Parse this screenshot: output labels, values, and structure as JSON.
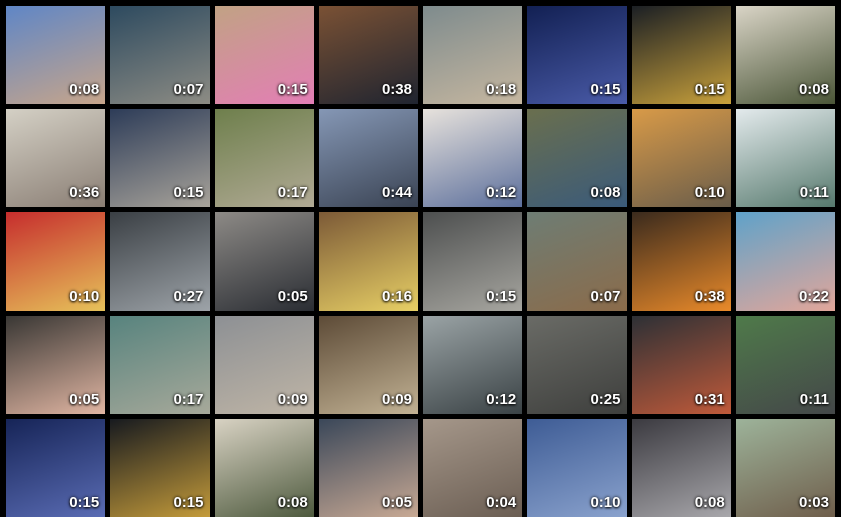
{
  "gallery": {
    "tiles": [
      {
        "duration": "0:08",
        "colors": [
          "#5f86c6",
          "#c7a58a"
        ]
      },
      {
        "duration": "0:07",
        "colors": [
          "#2d4a5f",
          "#8d8c84"
        ]
      },
      {
        "duration": "0:15",
        "colors": [
          "#c1a284",
          "#e37eb5"
        ]
      },
      {
        "duration": "0:38",
        "colors": [
          "#7a5134",
          "#1f2430"
        ]
      },
      {
        "duration": "0:18",
        "colors": [
          "#7e8b8d",
          "#c6b7a0"
        ]
      },
      {
        "duration": "0:15",
        "colors": [
          "#122053",
          "#4a5ba8"
        ]
      },
      {
        "duration": "0:15",
        "colors": [
          "#1b1f24",
          "#c9a13b"
        ]
      },
      {
        "duration": "0:08",
        "colors": [
          "#d9d4c6",
          "#4a5537"
        ]
      },
      {
        "duration": "0:36",
        "colors": [
          "#d4d0c5",
          "#8a7e74"
        ]
      },
      {
        "duration": "0:15",
        "colors": [
          "#2d3c58",
          "#a8a39a"
        ]
      },
      {
        "duration": "0:17",
        "colors": [
          "#6e7f4c",
          "#b1aa95"
        ]
      },
      {
        "duration": "0:44",
        "colors": [
          "#8597b5",
          "#3a4353"
        ]
      },
      {
        "duration": "0:12",
        "colors": [
          "#e7e2dc",
          "#5c6f9c"
        ]
      },
      {
        "duration": "0:08",
        "colors": [
          "#6a6f4e",
          "#3a5a7a"
        ]
      },
      {
        "duration": "0:10",
        "colors": [
          "#d89a48",
          "#6a5d4a"
        ]
      },
      {
        "duration": "0:11",
        "colors": [
          "#e3eaec",
          "#56796d"
        ]
      },
      {
        "duration": "0:10",
        "colors": [
          "#c62d2d",
          "#e6c25a"
        ]
      },
      {
        "duration": "0:27",
        "colors": [
          "#3a3f44",
          "#9da3a8"
        ]
      },
      {
        "duration": "0:05",
        "colors": [
          "#8d8a86",
          "#2a2d33"
        ]
      },
      {
        "duration": "0:16",
        "colors": [
          "#7c5a37",
          "#e7cf65"
        ]
      },
      {
        "duration": "0:15",
        "colors": [
          "#4d4f4f",
          "#a7a6a0"
        ]
      },
      {
        "duration": "0:07",
        "colors": [
          "#6e7d74",
          "#8b6b4a"
        ]
      },
      {
        "duration": "0:38",
        "colors": [
          "#3a2a1d",
          "#e98a2a"
        ]
      },
      {
        "duration": "0:22",
        "colors": [
          "#5fa2c9",
          "#e2a69a"
        ]
      },
      {
        "duration": "0:05",
        "colors": [
          "#393734",
          "#e0b5a2"
        ]
      },
      {
        "duration": "0:17",
        "colors": [
          "#57837e",
          "#a7a99a"
        ]
      },
      {
        "duration": "0:09",
        "colors": [
          "#8d9094",
          "#bfb5a6"
        ]
      },
      {
        "duration": "0:09",
        "colors": [
          "#5d4b37",
          "#c2b294"
        ]
      },
      {
        "duration": "0:12",
        "colors": [
          "#9aa3a5",
          "#3a4245"
        ]
      },
      {
        "duration": "0:25",
        "colors": [
          "#6a6b66",
          "#3e3f3d"
        ]
      },
      {
        "duration": "0:31",
        "colors": [
          "#2d3035",
          "#c05a3a"
        ]
      },
      {
        "duration": "0:11",
        "colors": [
          "#4f7a4a",
          "#444749"
        ]
      },
      {
        "duration": "0:15",
        "colors": [
          "#162457",
          "#5a6cb4"
        ]
      },
      {
        "duration": "0:15",
        "colors": [
          "#171a1f",
          "#c49b3a"
        ]
      },
      {
        "duration": "0:08",
        "colors": [
          "#d8d2c3",
          "#4e5a3e"
        ]
      },
      {
        "duration": "0:05",
        "colors": [
          "#3a4759",
          "#c8a994"
        ]
      },
      {
        "duration": "0:04",
        "colors": [
          "#a5978a",
          "#6b5e53"
        ]
      },
      {
        "duration": "0:10",
        "colors": [
          "#3e5c95",
          "#8aa2cd"
        ]
      },
      {
        "duration": "0:08",
        "colors": [
          "#3b3a40",
          "#a8a7ab"
        ]
      },
      {
        "duration": "0:03",
        "colors": [
          "#9db39a",
          "#6f5e4b"
        ]
      }
    ]
  }
}
